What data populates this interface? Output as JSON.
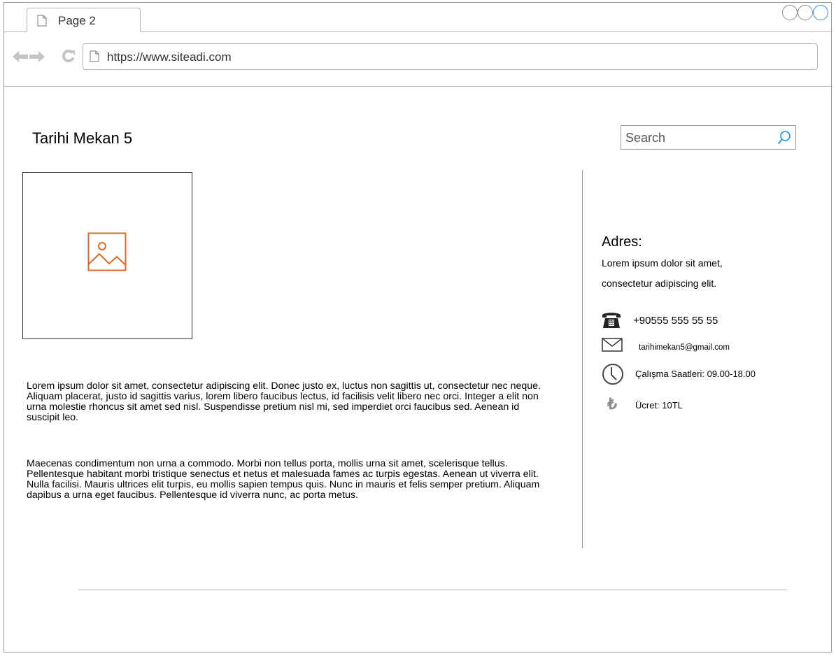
{
  "browser": {
    "tab_label": "Page 2",
    "url": "https://www.siteadi.com",
    "accent_color": "#1e8fe6"
  },
  "page": {
    "title": "Tarihi Mekan 5",
    "search_placeholder": "Search",
    "image_placeholder_icon": "image-icon",
    "paragraphs": [
      "Lorem ipsum dolor sit amet, consectetur adipiscing elit. Donec justo ex, luctus non sagittis ut, consectetur nec neque. Aliquam placerat, justo id sagittis varius, lorem libero faucibus lectus, id facilisis velit libero nec orci. Integer a elit non urna molestie rhoncus sit amet sed nisl. Suspendisse pretium nisl mi, sed imperdiet orci faucibus sed. Aenean id suscipit leo.",
      " Maecenas condimentum non urna a commodo. Morbi non tellus porta, mollis urna sit amet, scelerisque tellus. Pellentesque habitant morbi tristique senectus et netus et malesuada fames ac turpis egestas. Aenean ut viverra elit. Nulla facilisi. Mauris ultrices elit turpis, eu mollis sapien tempus quis. Nunc in mauris et felis semper pretium. Aliquam dapibus a urna eget faucibus. Pellentesque id viverra nunc, ac porta metus."
    ],
    "image_icon_color": "#d9692b"
  },
  "sidebar": {
    "address_title": "Adres:",
    "address_lines": [
      "Lorem ipsum dolor sit amet,",
      "consectetur adipiscing elit."
    ],
    "phone": "+90555 555 55 55",
    "email": "tarihimekan5@gmail.com",
    "hours": "Çalışma Saatleri: 09.00-18.00",
    "price": "Ücret: 10TL",
    "price_symbol": "₺"
  }
}
